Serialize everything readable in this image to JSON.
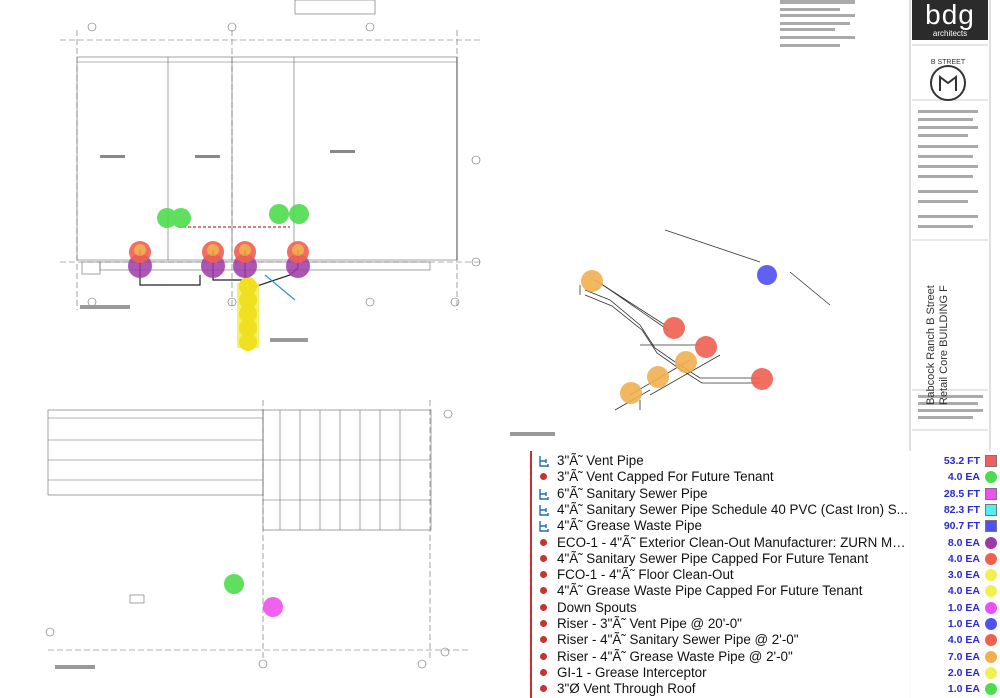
{
  "title_block": {
    "logo_text": "bdg",
    "logo_subtext": "architects",
    "seal_text": "B STREET",
    "project_name": "Babcock Ranch B Street",
    "project_subtitle": "Retail Core BUILDING F"
  },
  "legend": {
    "items": [
      {
        "label": "3\"Ã˜ Vent Pipe",
        "quantity": "53.2 FT",
        "marker": "bracket",
        "swatch_shape": "square",
        "color": "#f06060"
      },
      {
        "label": "3\"Ã˜ Vent Capped For Future Tenant",
        "quantity": "4.0 EA",
        "marker": "bullet",
        "swatch_shape": "circle",
        "color": "#4ddc4d"
      },
      {
        "label": "6\"Ã˜ Sanitary Sewer Pipe",
        "quantity": "28.5 FT",
        "marker": "bracket",
        "swatch_shape": "square",
        "color": "#f050f0"
      },
      {
        "label": "4\"Ã˜ Sanitary Sewer Pipe Schedule 40 PVC (Cast Iron) S...",
        "quantity": "82.3 FT",
        "marker": "bracket",
        "swatch_shape": "square",
        "color": "#50f0f0"
      },
      {
        "label": "4\"Ã˜ Grease Waste Pipe",
        "quantity": "90.7 FT",
        "marker": "bracket",
        "swatch_shape": "square",
        "color": "#5050f0"
      },
      {
        "label": "ECO-1 - 4\"Ã˜ Exterior Clean-Out Manufacturer: ZURN Mo...",
        "quantity": "8.0 EA",
        "marker": "bullet",
        "swatch_shape": "circle",
        "color": "#9e3aa8"
      },
      {
        "label": "4\"Ã˜ Sanitary Sewer Pipe Capped For Future Tenant",
        "quantity": "4.0 EA",
        "marker": "bullet",
        "swatch_shape": "circle",
        "color": "#f06050"
      },
      {
        "label": "FCO-1 - 4\"Ã˜ Floor Clean-Out",
        "quantity": "3.0 EA",
        "marker": "bullet",
        "swatch_shape": "circle",
        "color": "#f0f050"
      },
      {
        "label": "4\"Ã˜ Grease Waste Pipe Capped For Future Tenant",
        "quantity": "4.0 EA",
        "marker": "bullet",
        "swatch_shape": "circle",
        "color": "#f0f050"
      },
      {
        "label": "Down Spouts",
        "quantity": "1.0 EA",
        "marker": "bullet",
        "swatch_shape": "circle",
        "color": "#f050f0"
      },
      {
        "label": "Riser - 3\"Ã˜ Vent Pipe @ 20'-0\"",
        "quantity": "1.0 EA",
        "marker": "bullet",
        "swatch_shape": "circle",
        "color": "#5050f0"
      },
      {
        "label": "Riser - 4\"Ã˜ Sanitary Sewer Pipe @ 2'-0\"",
        "quantity": "4.0 EA",
        "marker": "bullet",
        "swatch_shape": "circle",
        "color": "#f06050"
      },
      {
        "label": "Riser - 4\"Ã˜ Grease Waste Pipe @ 2'-0\"",
        "quantity": "7.0 EA",
        "marker": "bullet",
        "swatch_shape": "circle",
        "color": "#f0b050"
      },
      {
        "label": "GI-1 - Grease Interceptor",
        "quantity": "2.0 EA",
        "marker": "bullet",
        "swatch_shape": "circle",
        "color": "#f0f050"
      },
      {
        "label": "3\"Ø Vent Through Roof",
        "quantity": "1.0 EA",
        "marker": "bullet",
        "swatch_shape": "circle",
        "color": "#4ddc4d"
      }
    ]
  },
  "colors": {
    "vent": "#4ddc4d",
    "sanitary": "#f06050",
    "cleanout": "#9e3aa8",
    "grease": "#f0b050",
    "interceptor": "#f0f050",
    "riser_vent": "#5050f0",
    "downspout": "#f050f0",
    "linework": "#555555"
  }
}
